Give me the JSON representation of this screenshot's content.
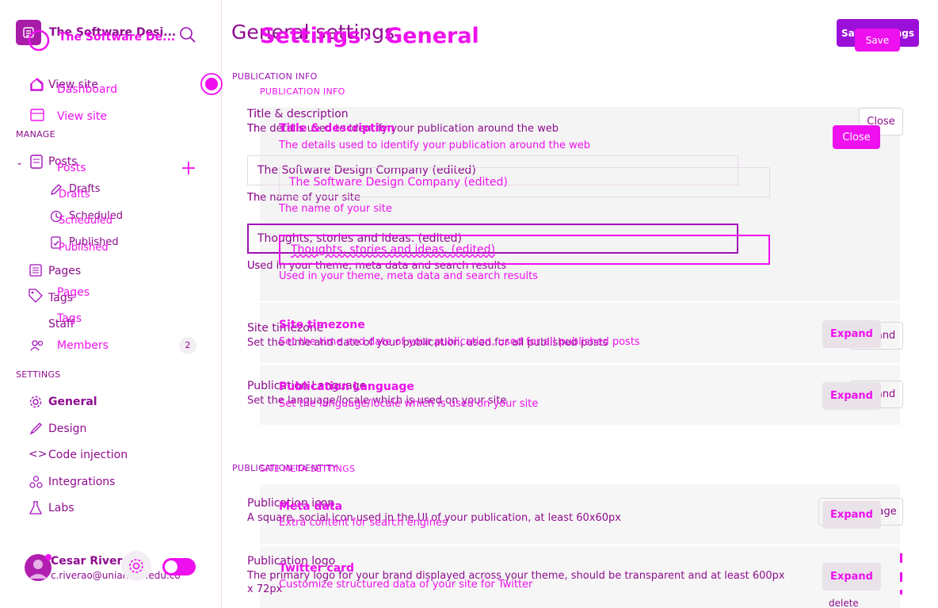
{
  "app": {
    "name": "The Software Desi...",
    "name_ghost": "The Software De..."
  },
  "header": {
    "title": "General settings",
    "breadcrumb_root": "Settings",
    "breadcrumb_sep": "›",
    "breadcrumb_current": "General",
    "save_label": "Save settings",
    "save_ghost": "Save"
  },
  "sidebar": {
    "view_site": "View site",
    "dashboard": "Dashboard",
    "view_site_2": "View site",
    "manage_heading": "MANAGE",
    "posts": "Posts",
    "posts_2": "Posts",
    "drafts": "Drafts",
    "drafts_2": "Drafts",
    "scheduled": "Scheduled",
    "scheduled_2": "Scheduled",
    "published": "Published",
    "published_2": "Published",
    "pages": "Pages",
    "pages_2": "Pages",
    "tags": "Tags",
    "tags_2": "Tags",
    "staff": "Staff",
    "members": "Members",
    "members_count": "2",
    "settings_heading": "SETTINGS",
    "general": "General",
    "design": "Design",
    "code_injection": "Code injection",
    "integrations": "Integrations",
    "labs": "Labs"
  },
  "user": {
    "name": "Cesar Rivera",
    "email": "c.riverao@uniandes.edu.co"
  },
  "publication_info": {
    "heading": "PUBLICATION INFO",
    "heading_2": "PUBLICATION INFO",
    "title_desc": {
      "label": "Title & description",
      "label_2": "Title & description",
      "desc": "The details used to identify your publication around the web",
      "desc_2": "The details used to identify your publication around the web",
      "close": "Close",
      "close_2": "Close",
      "title_value": "The Software Design Company (edited)",
      "title_value_2": "The Software Design Company (edited)",
      "title_help": "The name of your site",
      "title_help_2": "The name of your site",
      "desc_value": "Thoughts, stories and ideas. (edited)",
      "desc_value_2": "Thoughts, stories and ideas. (edited)",
      "desc_help": "Used in your theme, meta data and search results",
      "desc_help_2": "Used in your theme, meta data and search results"
    },
    "timezone": {
      "label": "Site timezone",
      "label_2": "Site timezone",
      "desc": "Set the time and date of your publication, used for all published posts",
      "desc_2": "Set the time and date of your publication, used for all published posts",
      "expand": "Expand",
      "expand_2": "Expand"
    },
    "language": {
      "label": "Publication Language",
      "label_2": "Publication Language",
      "desc": "Set the language/locale which is used on your site",
      "desc_2": "Set the language/locale which is used on your site",
      "expand": "Expand",
      "expand_2": "Expand"
    }
  },
  "publication_identity": {
    "heading": "PUBLICATION IDENTITY",
    "heading_2": "SITE META SETTINGS",
    "icon": {
      "label": "Publication icon",
      "desc": "A square, social icon used in the UI of your publication, at least 60x60px",
      "upload": "Upload Image"
    },
    "meta": {
      "label": "Meta data",
      "desc": "Extra content for search engines",
      "expand": "Expand"
    },
    "logo": {
      "label": "Publication logo",
      "desc_line1": "The primary logo for your brand displayed across your theme, should be transparent and at least 600px",
      "desc_line2": "x 72px"
    },
    "twitter": {
      "label": "Twitter card",
      "desc": "Customize structured data of your site for Twitter",
      "expand": "Expand",
      "delete": "delete"
    }
  },
  "colors": {
    "primary": "#8e0c8e",
    "accent": "#ee10ee",
    "save": "#9b10d8"
  },
  "icons": [
    "ghost-logo-icon",
    "search-icon",
    "home-icon",
    "external-icon",
    "posts-icon",
    "plus-icon",
    "pen-icon",
    "clock-icon",
    "published-icon",
    "pages-icon",
    "tag-icon",
    "members-icon",
    "gear-icon",
    "brush-icon",
    "code-icon",
    "integrations-icon",
    "labs-icon",
    "avatar"
  ]
}
